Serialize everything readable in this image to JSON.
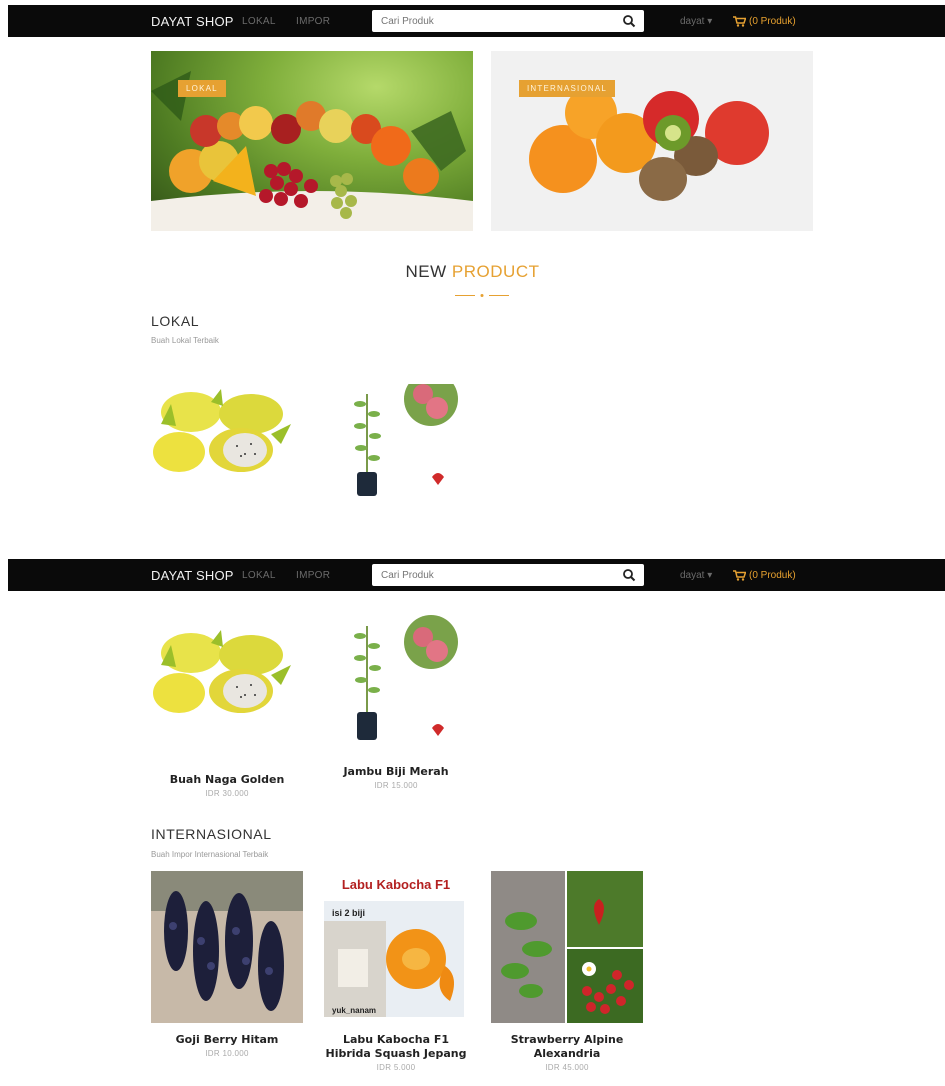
{
  "navbar": {
    "brand": "DAYAT SHOP",
    "links": [
      "LOKAL",
      "IMPOR"
    ],
    "search_placeholder": "Cari Produk",
    "user": "dayat ▾",
    "cart": "(0 Produk)"
  },
  "banners": {
    "lokal": "LOKAL",
    "internasional": "INTERNASIONAL"
  },
  "section": {
    "title_main": "NEW",
    "title_accent": "PRODUCT"
  },
  "lokal": {
    "heading": "LOKAL",
    "subheading": "Buah Lokal Terbaik",
    "products": [
      {
        "name": "Buah Naga Golden",
        "price": "IDR 30.000"
      },
      {
        "name": "Jambu Biji Merah",
        "price": "IDR 15.000"
      }
    ]
  },
  "internasional": {
    "heading": "INTERNASIONAL",
    "subheading": "Buah Impor Internasional Terbaik",
    "products": [
      {
        "name": "Goji Berry Hitam",
        "price": "IDR 10.000"
      },
      {
        "name": "Labu Kabocha F1 Hibrida Squash Jepang",
        "price": "IDR 5.000"
      },
      {
        "name": "Strawberry Alpine Alexandria",
        "price": "IDR 45.000"
      }
    ],
    "kabocha_image_text": {
      "title": "Labu Kabocha F1",
      "isi": "isi 2 biji",
      "tag": "yuk_nanam"
    }
  },
  "colors": {
    "navbar": "#0a0a0a",
    "accent": "#e6a132"
  }
}
